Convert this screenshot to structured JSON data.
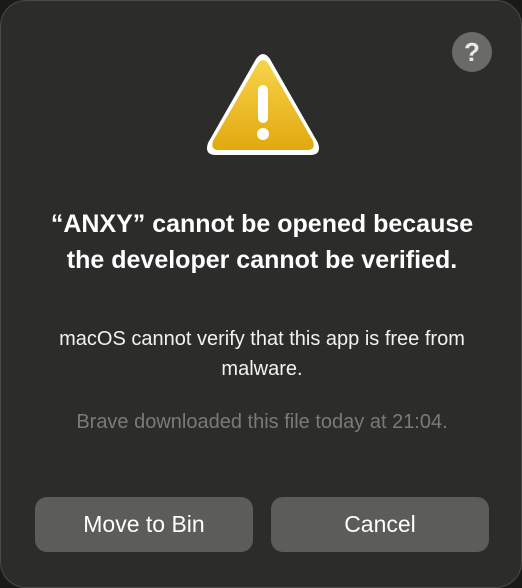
{
  "dialog": {
    "help_label": "?",
    "title": "“ANXY” cannot be opened because the developer cannot be verified.",
    "message": "macOS cannot verify that this app is free from malware.",
    "info": "Brave downloaded this file today at 21:04.",
    "buttons": {
      "move_to_bin": "Move to Bin",
      "cancel": "Cancel"
    },
    "icon": "warning-triangle",
    "colors": {
      "background": "#2c2c2a",
      "button": "#5c5c59",
      "warning_yellow": "#f2c21b",
      "secondary_text": "#7a7a77"
    }
  }
}
